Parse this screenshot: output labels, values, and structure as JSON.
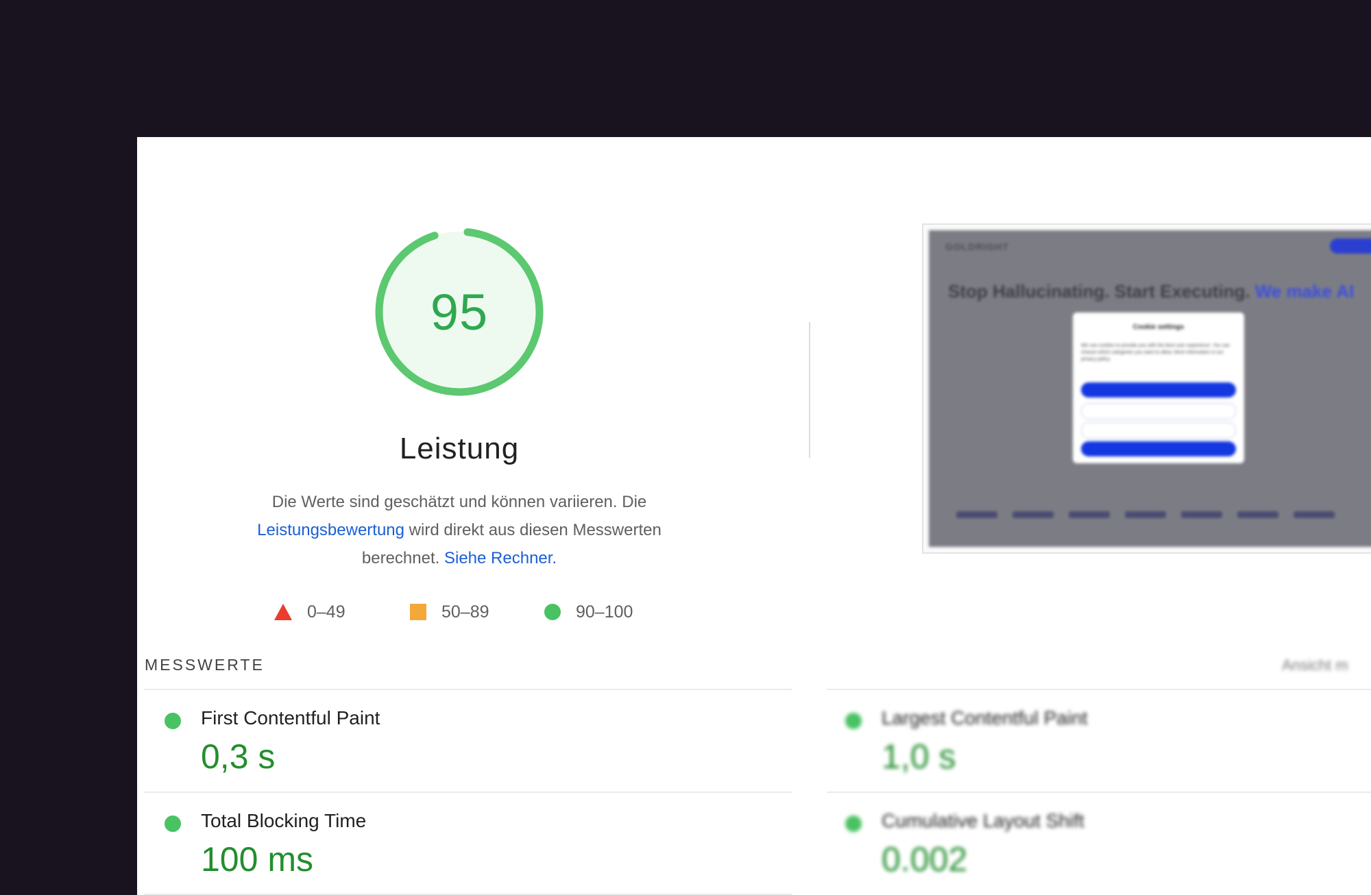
{
  "score": {
    "value": "95",
    "fraction": 0.95,
    "title": "Leistung",
    "ring_color": "#5cc86f",
    "fill_color": "#eefaf0"
  },
  "description": {
    "part1": "Die Werte sind geschätzt und können variieren. Die ",
    "link1": "Leistungsbewertung",
    "part2": " wird direkt aus diesen Messwerten berechnet. ",
    "link2": "Siehe Rechner."
  },
  "legend": [
    {
      "shape": "triangle",
      "color": "#eb3c2d",
      "label": "0–49"
    },
    {
      "shape": "square",
      "color": "#f4a83a",
      "label": "50–89"
    },
    {
      "shape": "circle",
      "color": "#49c263",
      "label": "90–100"
    }
  ],
  "screenshot": {
    "logo": "GOLDRIGHT",
    "headline": "Stop Hallucinating. Start Executing.",
    "headline_accent": "We make AI",
    "modal_title": "Cookie settings",
    "modal_text": "We use cookies to provide you with the best user experience. You can choose which categories you want to allow. More information in our privacy policy."
  },
  "metrics_section": {
    "label": "MESSWERTE",
    "view_toggle": "Ansicht m"
  },
  "metrics": [
    {
      "name": "First Contentful Paint",
      "value": "0,3 s"
    },
    {
      "name": "Largest Contentful Paint",
      "value": "1,0 s"
    },
    {
      "name": "Total Blocking Time",
      "value": "100 ms"
    },
    {
      "name": "Cumulative Layout Shift",
      "value": "0.002"
    }
  ]
}
